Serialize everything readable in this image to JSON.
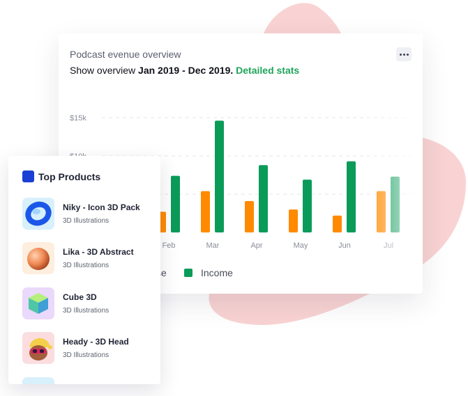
{
  "revenue_card": {
    "title": "Podcast evenue overview",
    "subtitle_prefix": "Show overview",
    "subtitle_dates": "Jan 2019 - Dec 2019.",
    "subtitle_link": "Detailed stats",
    "more_icon": "more-horizontal-icon"
  },
  "legend": [
    {
      "label": "se",
      "color": "#ff8a00"
    },
    {
      "label": "Income",
      "color": "#0b9b59"
    }
  ],
  "chart_data": {
    "type": "bar",
    "ylabel_ticks": [
      "$15k",
      "$10k"
    ],
    "ylim": [
      0,
      16000
    ],
    "categories": [
      "Feb",
      "Mar",
      "Apr",
      "May",
      "Jun",
      "Jul"
    ],
    "series": [
      {
        "name": "Expense",
        "color": "#ff8a00",
        "values": [
          2700,
          5400,
          4100,
          3000,
          2200,
          5400
        ]
      },
      {
        "name": "Income",
        "color": "#0b9b59",
        "values": [
          7400,
          14600,
          8800,
          6900,
          9300,
          7300
        ]
      }
    ]
  },
  "top_products": {
    "title": "Top Products",
    "icon": "square-icon",
    "items": [
      {
        "name": "Niky - Icon 3D Pack",
        "category": "3D Illustrations",
        "thumb_bg": "#d8f0fb",
        "icon": "3d-ring-icon"
      },
      {
        "name": "Lika - 3D Abstract",
        "category": "3D Illustrations",
        "thumb_bg": "#fdeedd",
        "icon": "3d-sphere-icon"
      },
      {
        "name": "Cube 3D",
        "category": "3D Illustrations",
        "thumb_bg": "#ead9fb",
        "icon": "3d-cube-icon"
      },
      {
        "name": "Heady - 3D Head",
        "category": "3D Illustrations",
        "thumb_bg": "#fbdde0",
        "icon": "3d-head-icon"
      }
    ]
  }
}
